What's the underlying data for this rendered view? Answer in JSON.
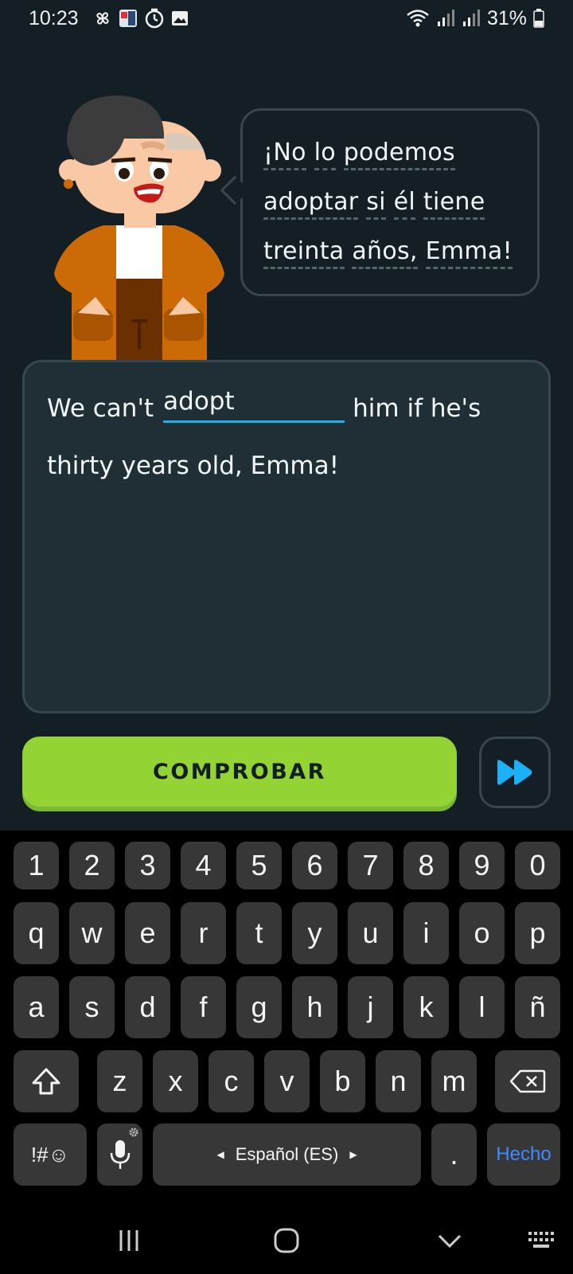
{
  "status_bar": {
    "time": "10:23",
    "battery": "31%",
    "icons": [
      "pinwheel-icon",
      "app-thumbnail-icon",
      "timer-icon",
      "image-icon",
      "wifi-icon",
      "signal-icon",
      "signal-icon",
      "battery-icon"
    ]
  },
  "speech_bubble": {
    "lines": [
      [
        "¡No",
        "lo",
        "podemos"
      ],
      [
        "adoptar",
        "si",
        "él",
        "tiene"
      ],
      [
        "treinta",
        "años,",
        "Emma!"
      ]
    ]
  },
  "answer": {
    "before_blank": "We can't",
    "typed_value": "adopt",
    "after_blank": "him if he's",
    "line2": "thirty years old, Emma!"
  },
  "actions": {
    "check_label": "COMPROBAR",
    "skip_icon": "fast-forward-icon"
  },
  "keyboard": {
    "row_numbers": [
      "1",
      "2",
      "3",
      "4",
      "5",
      "6",
      "7",
      "8",
      "9",
      "0"
    ],
    "row_top": [
      "q",
      "w",
      "e",
      "r",
      "t",
      "y",
      "u",
      "i",
      "o",
      "p"
    ],
    "row_middle": [
      "a",
      "s",
      "d",
      "f",
      "g",
      "h",
      "j",
      "k",
      "l",
      "ñ"
    ],
    "row_bottom": [
      "z",
      "x",
      "c",
      "v",
      "b",
      "n",
      "m"
    ],
    "symbols_label": "!#☺",
    "space_label": "Español (ES)",
    "period_label": ".",
    "done_label": "Hecho"
  },
  "colors": {
    "background": "#131f24",
    "card": "#202f36",
    "border": "#37464f",
    "accent_blue": "#1cb0f6",
    "button_green": "#93d333",
    "done_blue": "#3d8bff"
  }
}
